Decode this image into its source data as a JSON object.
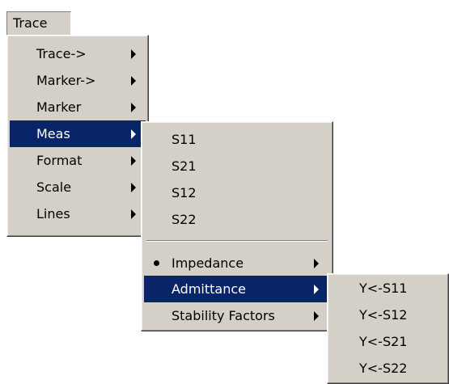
{
  "menubar": {
    "trace_label": "Trace"
  },
  "trace_menu": {
    "items": [
      {
        "label": "Trace->"
      },
      {
        "label": "Marker->"
      },
      {
        "label": "Marker"
      },
      {
        "label": "Meas"
      },
      {
        "label": "Format"
      },
      {
        "label": "Scale"
      },
      {
        "label": "Lines"
      }
    ],
    "highlighted": "Meas"
  },
  "meas_menu": {
    "s_params": [
      {
        "label": "S11"
      },
      {
        "label": "S21"
      },
      {
        "label": "S12"
      },
      {
        "label": "S22"
      }
    ],
    "modes": [
      {
        "label": "Impedance",
        "checked": true
      },
      {
        "label": "Admittance",
        "checked": false
      },
      {
        "label": "Stability Factors",
        "checked": false
      }
    ],
    "highlighted": "Admittance"
  },
  "admittance_menu": {
    "items": [
      {
        "label": "Y<-S11"
      },
      {
        "label": "Y<-S12"
      },
      {
        "label": "Y<-S21"
      },
      {
        "label": "Y<-S22"
      }
    ]
  },
  "colors": {
    "menu_bg": "#d4d0c8",
    "highlight_bg": "#0a246a",
    "highlight_text": "#ffffff"
  }
}
